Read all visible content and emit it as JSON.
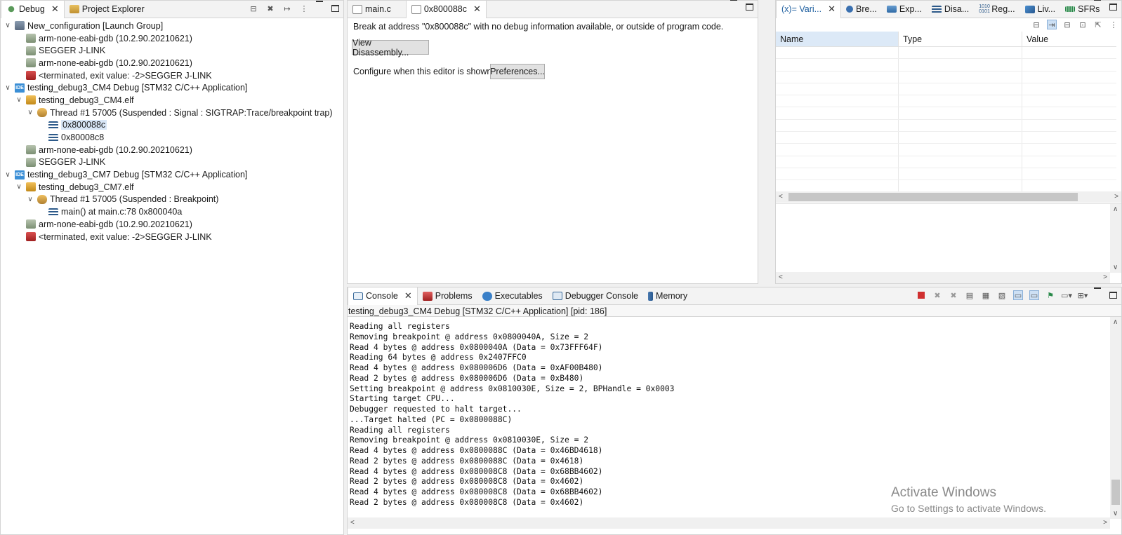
{
  "debug_view": {
    "tabs": [
      {
        "label": "Debug",
        "active": true
      },
      {
        "label": "Project Explorer",
        "active": false
      }
    ],
    "tree": [
      {
        "indent": 0,
        "toggle": "∨",
        "icon": "launch-group-icon",
        "label": "New_configuration [Launch Group]"
      },
      {
        "indent": 1,
        "toggle": "",
        "icon": "gdb-process-icon",
        "label": "arm-none-eabi-gdb (10.2.90.20210621)"
      },
      {
        "indent": 1,
        "toggle": "",
        "icon": "gdb-process-icon",
        "label": "SEGGER J-LINK"
      },
      {
        "indent": 1,
        "toggle": "",
        "icon": "gdb-process-icon",
        "label": "arm-none-eabi-gdb (10.2.90.20210621)"
      },
      {
        "indent": 1,
        "toggle": "",
        "icon": "terminated-process-icon",
        "label": "<terminated, exit value: -2>SEGGER J-LINK"
      },
      {
        "indent": 0,
        "toggle": "∨",
        "icon": "ide-launch-icon",
        "label": "testing_debug3_CM4 Debug [STM32 C/C++ Application]"
      },
      {
        "indent": 1,
        "toggle": "∨",
        "icon": "elf-target-icon",
        "label": "testing_debug3_CM4.elf"
      },
      {
        "indent": 2,
        "toggle": "∨",
        "icon": "suspended-thread-icon",
        "label": "Thread #1 57005 (Suspended : Signal : SIGTRAP:Trace/breakpoint trap)"
      },
      {
        "indent": 3,
        "toggle": "",
        "icon": "stack-frame-icon",
        "label": "0x800088c",
        "selected": true
      },
      {
        "indent": 3,
        "toggle": "",
        "icon": "stack-frame-icon",
        "label": "0x80008c8"
      },
      {
        "indent": 1,
        "toggle": "",
        "icon": "gdb-process-icon",
        "label": "arm-none-eabi-gdb (10.2.90.20210621)"
      },
      {
        "indent": 1,
        "toggle": "",
        "icon": "gdb-process-icon",
        "label": "SEGGER J-LINK"
      },
      {
        "indent": 0,
        "toggle": "∨",
        "icon": "ide-launch-icon",
        "label": "testing_debug3_CM7 Debug [STM32 C/C++ Application]"
      },
      {
        "indent": 1,
        "toggle": "∨",
        "icon": "elf-target-icon",
        "label": "testing_debug3_CM7.elf"
      },
      {
        "indent": 2,
        "toggle": "∨",
        "icon": "suspended-thread-icon",
        "label": "Thread #1 57005 (Suspended : Breakpoint)"
      },
      {
        "indent": 3,
        "toggle": "",
        "icon": "stack-frame-icon",
        "label": "main() at main.c:78 0x800040a"
      },
      {
        "indent": 1,
        "toggle": "",
        "icon": "gdb-process-icon",
        "label": "arm-none-eabi-gdb (10.2.90.20210621)"
      },
      {
        "indent": 1,
        "toggle": "",
        "icon": "terminated-process-icon",
        "label": "<terminated, exit value: -2>SEGGER J-LINK"
      }
    ]
  },
  "editor": {
    "tabs": [
      {
        "label": "main.c",
        "active": false
      },
      {
        "label": "0x800088c",
        "active": true
      }
    ],
    "message": "Break at address \"0x800088c\" with no debug information available, or outside of program code.",
    "view_disassembly_label": "View Disassembly...",
    "configure_label": "Configure when this editor is shown",
    "preferences_label": "Preferences..."
  },
  "variables_view": {
    "tabs": [
      "(x)= Vari...",
      "Bre...",
      "Exp...",
      "Disa...",
      "Reg...",
      "Liv...",
      "SFRs"
    ],
    "columns": [
      "Name",
      "Type",
      "Value"
    ]
  },
  "console_view": {
    "tabs": [
      "Console",
      "Problems",
      "Executables",
      "Debugger Console",
      "Memory"
    ],
    "session": "testing_debug3_CM4 Debug [STM32 C/C++ Application]  [pid: 186]",
    "lines": [
      "Reading all registers",
      "Removing breakpoint @ address 0x0800040A, Size = 2",
      "Read 4 bytes @ address 0x0800040A (Data = 0x73FFF64F)",
      "Reading 64 bytes @ address 0x2407FFC0",
      "Read 4 bytes @ address 0x080006D6 (Data = 0xAF00B480)",
      "Read 2 bytes @ address 0x080006D6 (Data = 0xB480)",
      "Setting breakpoint @ address 0x0810030E, Size = 2, BPHandle = 0x0003",
      "Starting target CPU...",
      "Debugger requested to halt target...",
      "...Target halted (PC = 0x0800088C)",
      "Reading all registers",
      "Removing breakpoint @ address 0x0810030E, Size = 2",
      "Read 4 bytes @ address 0x0800088C (Data = 0x46BD4618)",
      "Read 2 bytes @ address 0x0800088C (Data = 0x4618)",
      "Read 4 bytes @ address 0x080008C8 (Data = 0x68BB4602)",
      "Read 2 bytes @ address 0x080008C8 (Data = 0x4602)",
      "Read 4 bytes @ address 0x080008C8 (Data = 0x68BB4602)",
      "Read 2 bytes @ address 0x080008C8 (Data = 0x4602)"
    ]
  },
  "watermark": {
    "title": "Activate Windows",
    "subtitle": "Go to Settings to activate Windows."
  }
}
